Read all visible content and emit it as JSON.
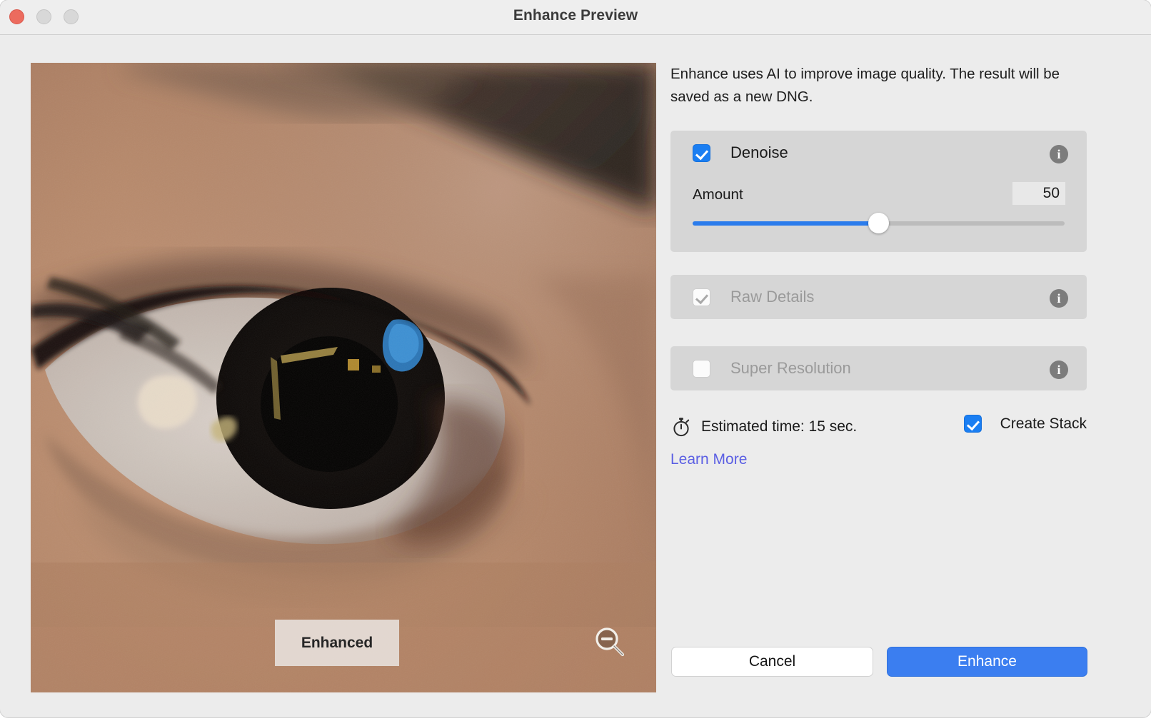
{
  "window": {
    "title": "Enhance Preview",
    "controls": [
      {
        "name": "close",
        "color": "#ec6b5e"
      },
      {
        "name": "minimize",
        "color": "#d8d8d8"
      },
      {
        "name": "maximize",
        "color": "#d8d8d8"
      }
    ]
  },
  "preview": {
    "badge_label": "Enhanced",
    "zoom_icon": "zoom-out-magnifier-icon",
    "image_subject": "macro photograph of a human eye"
  },
  "panel": {
    "description": "Enhance uses AI to improve image quality. The result will be saved as a new DNG.",
    "options": [
      {
        "id": "denoise",
        "label": "Denoise",
        "checked": true,
        "disabled": false,
        "info_icon": "info-icon",
        "amount_label": "Amount",
        "amount_value": "50",
        "slider_percent": 50
      },
      {
        "id": "raw_details",
        "label": "Raw Details",
        "checked": true,
        "disabled": true,
        "info_icon": "info-icon"
      },
      {
        "id": "super_resolution",
        "label": "Super Resolution",
        "checked": false,
        "disabled": true,
        "info_icon": "info-icon"
      }
    ],
    "estimate": {
      "icon": "stopwatch-icon",
      "text": "Estimated time: 15 sec."
    },
    "create_stack": {
      "label": "Create Stack",
      "checked": true
    },
    "learn_more": "Learn More"
  },
  "footer": {
    "cancel_label": "Cancel",
    "enhance_label": "Enhance"
  },
  "colors": {
    "accent_blue": "#3b7ef0",
    "checkbox_blue": "#1a7ef2",
    "slider_blue": "#2b7cec",
    "link_blue": "#5b5fe3",
    "panel_bg": "#ececec",
    "card_bg": "#d6d6d6",
    "close_red": "#ec6b5e"
  }
}
